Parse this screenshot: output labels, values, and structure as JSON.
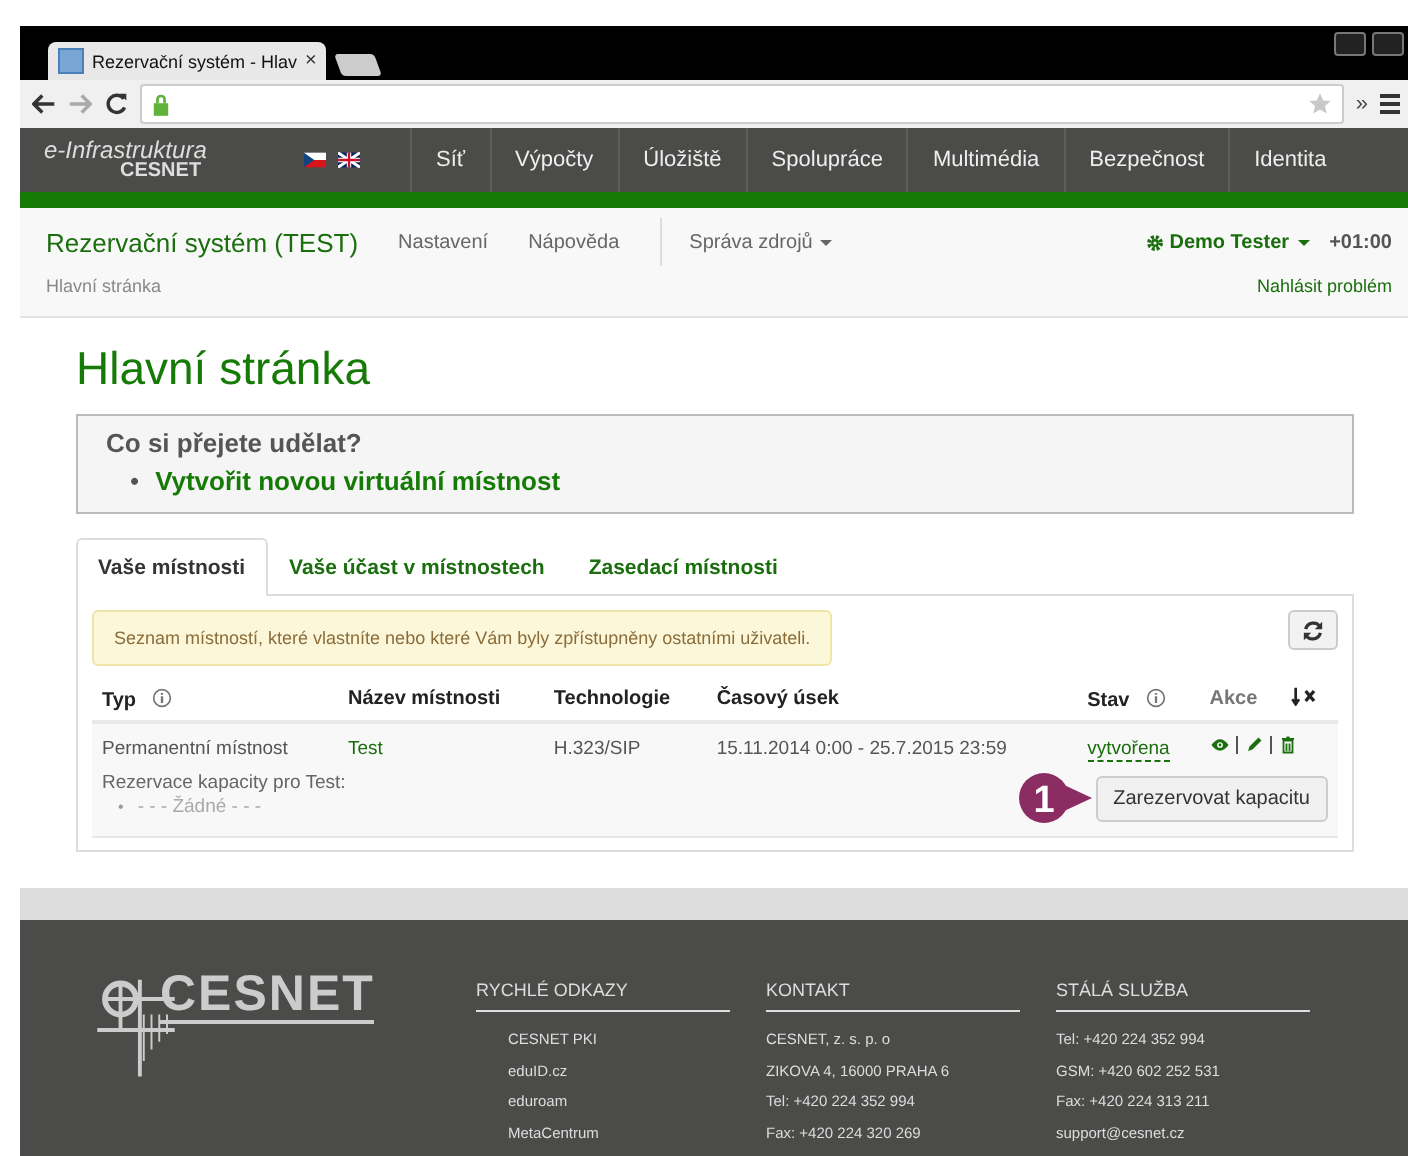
{
  "browser": {
    "tab_title": "Rezervační systém - Hlav",
    "tab_close": "×",
    "overflow": "»"
  },
  "topnav": {
    "logo_line1": "e-Infrastruktura",
    "logo_line2": "CESNET",
    "items": [
      "Síť",
      "Výpočty",
      "Úložiště",
      "Spolupráce",
      "Multimédia",
      "Bezpečnost",
      "Identita"
    ]
  },
  "header": {
    "app_title": "Rezervační systém (TEST)",
    "menu": [
      {
        "label": "Nastavení",
        "dropdown": false
      },
      {
        "label": "Nápověda",
        "dropdown": false
      },
      {
        "label": "Správa zdrojů",
        "dropdown": true
      }
    ],
    "user": "Demo Tester",
    "timezone": "+01:00",
    "breadcrumb": "Hlavní stránka",
    "report": "Nahlásit problém"
  },
  "page_title": "Hlavní stránka",
  "actions_box": {
    "question": "Co si přejete udělat?",
    "bullet": "•",
    "links": [
      "Vytvořit novou virtuální místnost"
    ]
  },
  "tabs": [
    {
      "label": "Vaše místnosti",
      "selected": true
    },
    {
      "label": "Vaše účast v místnostech",
      "selected": false
    },
    {
      "label": "Zasedací místnosti",
      "selected": false
    }
  ],
  "notice": "Seznam místností, které vlastníte nebo které Vám byly zpřístupněny ostatními uživateli.",
  "table": {
    "columns": [
      {
        "label": "Typ",
        "info": true
      },
      {
        "label": "Název místnosti",
        "info": false
      },
      {
        "label": "Technologie",
        "info": false
      },
      {
        "label": "Časový úsek",
        "info": false
      },
      {
        "label": "Stav",
        "info": true
      },
      {
        "label": "Akce",
        "info": false
      }
    ],
    "rows": [
      {
        "type": "Permanentní místnost",
        "name": "Test",
        "technology": "H.323/SIP",
        "period": "15.11.2014 0:00 - 25.7.2015 23:59",
        "state": "vytvořena",
        "capacity_label": "Rezervace kapacity pro Test:",
        "capacity_bullet": "•",
        "capacity_items": [
          "- - - Žádné - - -"
        ],
        "reserve_button": "Zarezervovat kapacitu"
      }
    ]
  },
  "callout": "1",
  "footer": {
    "logo": "CESNET",
    "columns": [
      {
        "heading": "RYCHLÉ ODKAZY",
        "indent": true,
        "lines": [
          "CESNET PKI",
          "eduID.cz",
          "eduroam",
          "MetaCentrum"
        ]
      },
      {
        "heading": "KONTAKT",
        "indent": false,
        "lines": [
          "CESNET, z. s. p. o",
          "ZIKOVA 4, 16000 PRAHA 6",
          "Tel: +420 224 352 994",
          "Fax: +420 224 320 269"
        ]
      },
      {
        "heading": "STÁLÁ SLUŽBA",
        "indent": false,
        "lines": [
          "Tel: +420 224 352 994",
          "GSM: +420 602 252 531",
          "Fax: +420 224 313 211",
          "support@cesnet.cz"
        ]
      }
    ]
  }
}
